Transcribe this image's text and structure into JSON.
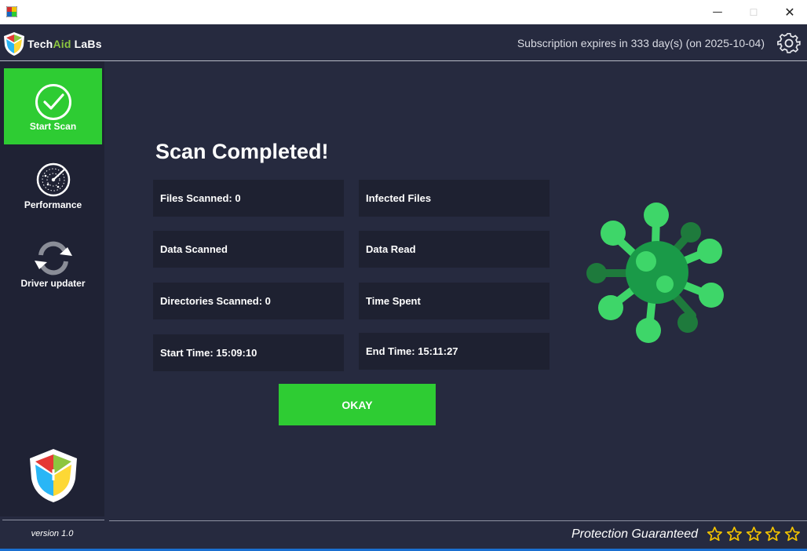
{
  "window": {
    "minimize_glyph": "—",
    "maximize_glyph": "☐",
    "close_glyph": "✕"
  },
  "header": {
    "brand_part1": "Tech",
    "brand_part2": "Aid",
    "brand_part3": " LaBs",
    "subscription": "Subscription expires in 333 day(s) (on 2025-10-04)",
    "settings_icon": "gear-icon"
  },
  "sidebar": {
    "items": [
      {
        "label": "Start Scan",
        "icon": "check-circle-icon",
        "active": true
      },
      {
        "label": "Performance",
        "icon": "radar-icon",
        "active": false
      },
      {
        "label": "Driver updater",
        "icon": "refresh-icon",
        "active": false
      }
    ],
    "version": "version 1.0"
  },
  "scan": {
    "title": "Scan Completed!",
    "stats": [
      {
        "label": "Files Scanned: 0"
      },
      {
        "label": "Infected Files"
      },
      {
        "label": "Data Scanned"
      },
      {
        "label": "Data Read"
      },
      {
        "label": "Directories Scanned: 0"
      },
      {
        "label": "Time Spent"
      },
      {
        "label": "Start Time: 15:09:10"
      },
      {
        "label": "End Time: 15:11:27"
      }
    ],
    "okay_label": "OKAY"
  },
  "footer": {
    "protection": "Protection Guaranteed",
    "rating": 0,
    "rating_max": 5
  },
  "colors": {
    "accent_green": "#2ecc33",
    "background": "#262a3f",
    "sidebar_bg": "#1f2234",
    "star_color": "#f2c300"
  }
}
